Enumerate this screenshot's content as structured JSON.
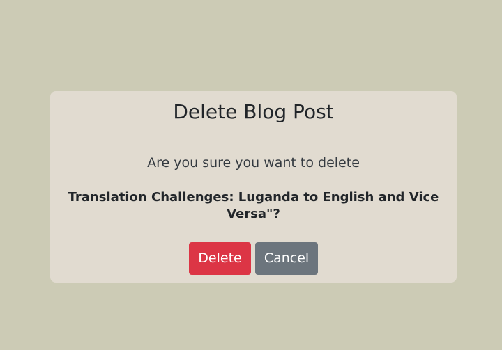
{
  "dialog": {
    "title": "Delete Blog Post",
    "question": "Are you sure you want to delete",
    "post_title": "Translation Challenges: Luganda to English and Vice Versa\"?",
    "delete_label": "Delete",
    "cancel_label": "Cancel"
  },
  "colors": {
    "page_background": "#cccbb5",
    "dialog_background": "#e1dbd0",
    "delete_button": "#dc3545",
    "cancel_button": "#6c757d"
  }
}
